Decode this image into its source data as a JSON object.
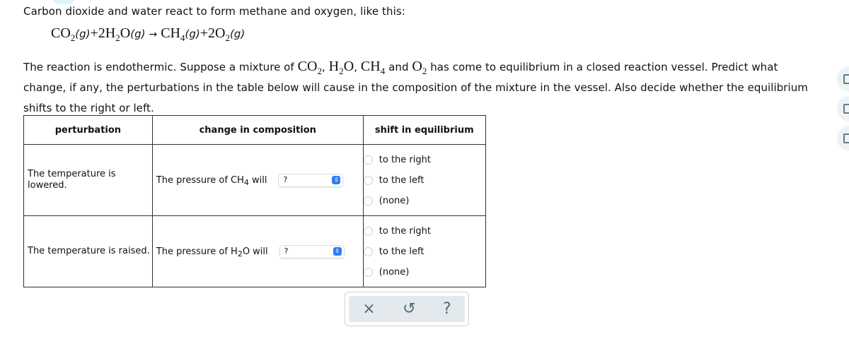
{
  "intro": "Carbon dioxide and water react to form methane and oxygen, like this:",
  "equation": {
    "reactant1": "CO",
    "reactant1_sub": "2",
    "reactant1_state": "(g)",
    "plus1": "+2H",
    "reactant2_sub": "2",
    "reactant2_tail": "O",
    "reactant2_state": "(g)",
    "arrow": "→",
    "product1": "CH",
    "product1_sub": "4",
    "product1_state": "(g)",
    "plus2": "+2O",
    "product2_sub": "2",
    "product2_state": "(g)"
  },
  "paragraph": {
    "part1": "The reaction is endothermic. Suppose a mixture of ",
    "sp1": "CO",
    "sp1_sub": "2",
    "sep1": ", ",
    "sp2a": "H",
    "sp2_sub": "2",
    "sp2b": "O",
    "sep2": ", ",
    "sp3": "CH",
    "sp3_sub": "4",
    "sep3": " and ",
    "sp4": "O",
    "sp4_sub": "2",
    "part2": " has come to equilibrium in a closed reaction vessel. Predict what change, if any, the perturbations in the table below will cause in the composition of the mixture in the vessel. Also decide whether the equilibrium shifts to the right or left."
  },
  "table": {
    "headers": [
      "perturbation",
      "change in composition",
      "shift in equilibrium"
    ],
    "rows": [
      {
        "perturbation": "The temperature is lowered.",
        "comp_prefix": "The pressure of CH",
        "comp_sub": "4",
        "comp_suffix": " will",
        "select_value": "?",
        "options": [
          "to the right",
          "to the left",
          "(none)"
        ]
      },
      {
        "perturbation": "The temperature is raised.",
        "comp_prefix": "The pressure of H",
        "comp_sub": "2",
        "comp_suffix": "O will",
        "select_value": "?",
        "options": [
          "to the right",
          "to the left",
          "(none)"
        ]
      }
    ]
  },
  "toolbar": {
    "close_icon": "×",
    "undo_icon": "↺",
    "help_icon": "?"
  },
  "side_tools": [
    "calculator-icon",
    "data-icon",
    "periodic-table-icon"
  ],
  "colors": {
    "select_accent": "#2f7df6",
    "toolbar_bg": "#e3e9ec",
    "toolbar_icon": "#4e6b7a"
  }
}
